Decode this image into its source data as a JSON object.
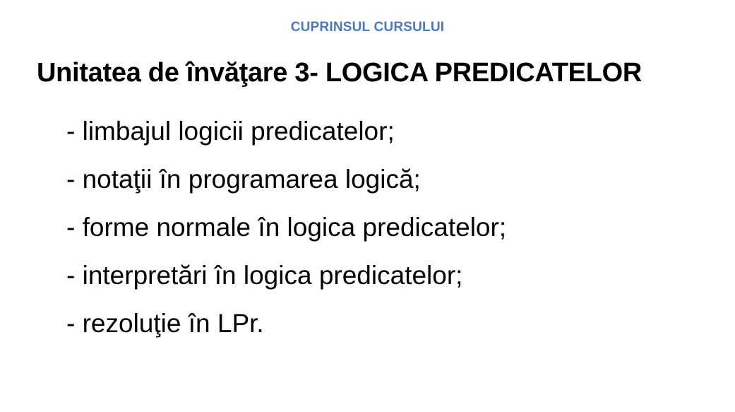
{
  "slide": {
    "header": "CUPRINSUL CURSULUI",
    "header_color": "#4a7ab9",
    "title": "Unitatea de învăţare 3- LOGICA PREDICATELOR",
    "items": [
      {
        "text": "- limbajul logicii predicatelor;"
      },
      {
        "text": "- notaţii în programarea logică;"
      },
      {
        "text": "- forme normale în logica predicatelor;"
      },
      {
        "text": "- interpretări în logica predicatelor;"
      },
      {
        "text": "- rezoluţie în LPr."
      }
    ]
  }
}
